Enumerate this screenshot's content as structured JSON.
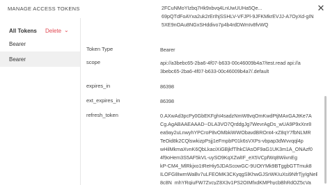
{
  "dialog": {
    "title": "MANAGE ACCESS TOKENS",
    "close_icon": "close-icon"
  },
  "sidebar": {
    "heading": "All Tokens",
    "delete_label": "Delete",
    "delete_color": "#e0454f",
    "tokens": [
      {
        "label": "Bearer"
      },
      {
        "label": "Bearer"
      }
    ]
  },
  "details": {
    "previous_value_lines": [
      "2FCuNMoYIzbq7Hk9xbvq4LnUwUUHa5Qe...",
      "69pQTdFoAYxa2uk2rErIhjSSHLV-VFJPl-9JFKMkrEVJJ-A7OyXd-gIN",
      "5XE9nOAu8NGxSHddivo7p4b4rdDWmIv8fvWQ"
    ],
    "fields": [
      {
        "label": "Token Type",
        "lines": [
          "Bearer"
        ]
      },
      {
        "label": "scope",
        "lines": [
          "api://a3bebc65-2ba6-4f07-b633-00c46009b4a7/test.read api://a",
          "3bebc65-2ba6-4f07-b633-00c46009b4a7/.default"
        ]
      },
      {
        "label": "expires_in",
        "lines": [
          "86398"
        ]
      },
      {
        "label": "ext_expires_in",
        "lines": [
          "86398"
        ]
      },
      {
        "label": "refresh_token",
        "lines": [
          "0.AXwAd3pcPy0GbEKFghI4sadzNmW8vqOmKwdPtjMAxGAJtKe7A",
          "Cg.AgABAAEAAAD--DLA3VO7QrddgJg7WevrAgDs_wUA9P9xXnr8",
          "ea9ay2uLnwyhYPCroP8vOMbkiWWObavdBROnt4-xZ8qY7fbNLMR",
          "TeOid8k2CQlswkizpPsjj1eFmpbP01k6sVXPs-vbpap3dWvvqql4p",
          "wHilMkmaXvnK6QbLkaciXiGBjkfTlhkClAsOF9aG1UK3m1A_ONAzf0",
          "4f9oHem3S5AF5kVL-uySO9KqXZwlIF_eX5VCpfWq8WiivnEg",
          "kP-CM4_MlRkjxo1tReHiy5JDAScowGC-9UOtYMk9BTggbGTTmuk8",
          "ILOFG8IwmWaBv7uLFEOMK3CKyqgSlKhwGJSrWKIuXsi9NfrTjyIgNeE6p",
          "8c8N_mhYRqiuFW7ZvcyZ8X3v1PS2OIMfxdKMPhycbBhRdOZ5cVa"
        ]
      }
    ]
  },
  "scrollbar": {
    "position_fraction": 0.47
  }
}
